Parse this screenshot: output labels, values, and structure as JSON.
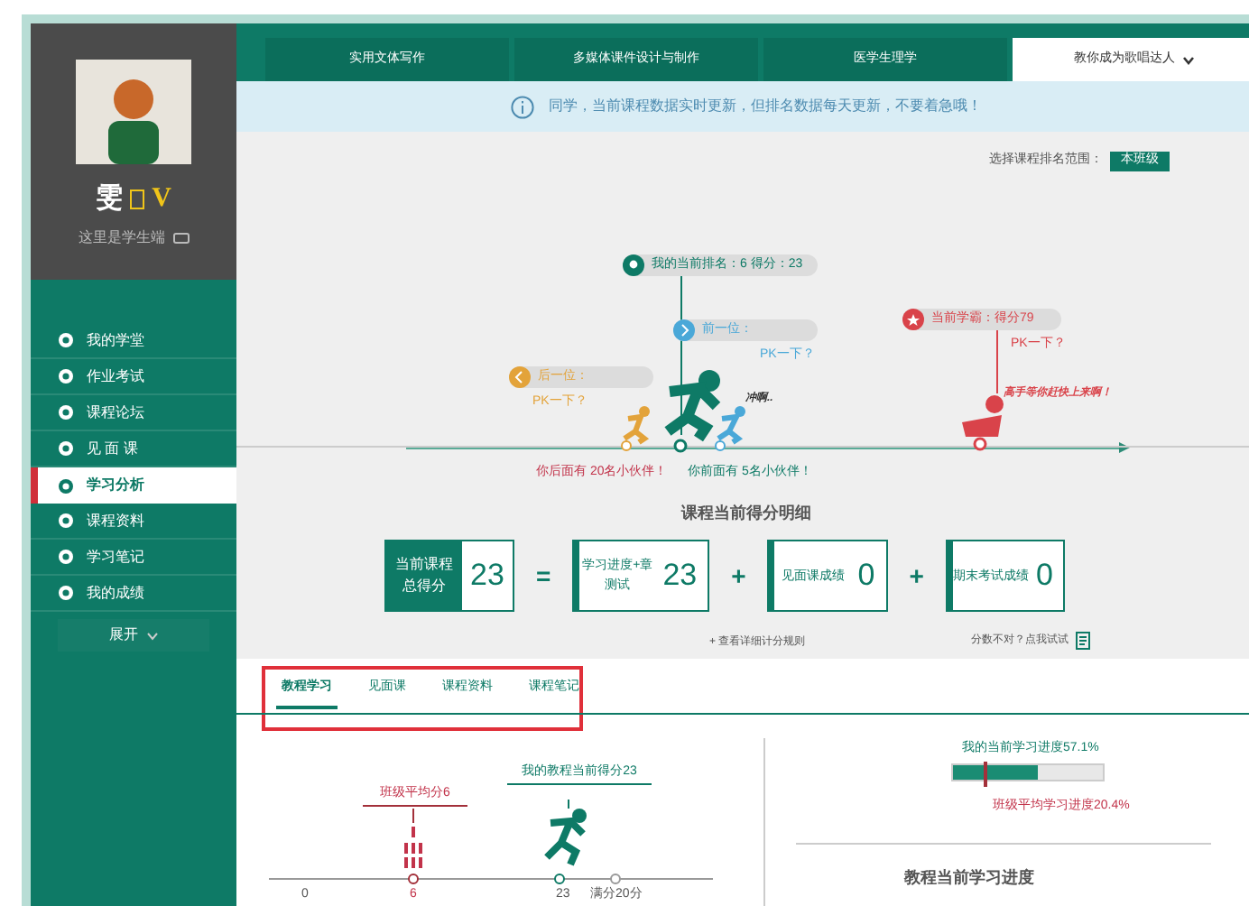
{
  "profile": {
    "name": "雯",
    "badge": "V",
    "subtitle": "这里是学生端"
  },
  "nav": [
    {
      "label": "我的学堂",
      "selected": false
    },
    {
      "label": "作业考试",
      "selected": false
    },
    {
      "label": "课程论坛",
      "selected": false
    },
    {
      "label": "见 面 课",
      "selected": false
    },
    {
      "label": "学习分析",
      "selected": true
    },
    {
      "label": "课程资料",
      "selected": false
    },
    {
      "label": "学习笔记",
      "selected": false
    },
    {
      "label": "我的成绩",
      "selected": false
    }
  ],
  "expand_button": "展开",
  "course_tabs": [
    {
      "label": "实用文体写作",
      "selected": false
    },
    {
      "label": "多媒体课件设计与制作",
      "selected": false
    },
    {
      "label": "医学生理学",
      "selected": false
    },
    {
      "label": "教你成为歌唱达人",
      "selected": true
    }
  ],
  "notice": "同学，当前课程数据实时更新，但排名数据每天更新，不要着急哦！",
  "range": {
    "label": "选择课程排名范围：",
    "value": "本班级"
  },
  "race": {
    "my_rank": "我的当前排名：6 得分：23",
    "next": {
      "label": "前一位：",
      "pk": "PK一下？"
    },
    "prev": {
      "label": "后一位：",
      "pk": "PK一下？"
    },
    "leader": {
      "label": "当前学霸：得分79",
      "pk": "PK一下？",
      "slogan": "高手等你赶快上来啊！"
    },
    "cheer": "冲啊..",
    "behind_text": "你后面有 20名小伙伴！",
    "ahead_text": "你前面有 5名小伙伴！"
  },
  "score": {
    "title": "课程当前得分明细",
    "total_label": "当前课程总得分",
    "total": "23",
    "parts": [
      {
        "operator": "=",
        "label": "学习进度+章测试",
        "value": "23"
      },
      {
        "operator": "+",
        "label": "见面课成绩",
        "value": "0"
      },
      {
        "operator": "+",
        "label": "期末考试成绩",
        "value": "0"
      }
    ],
    "rules_link": "+ 查看详细计分规则",
    "feedback": "分数不对？点我试试"
  },
  "detail_tabs": [
    {
      "label": "教程学习",
      "selected": true
    },
    {
      "label": "见面课",
      "selected": false
    },
    {
      "label": "课程资料",
      "selected": false
    },
    {
      "label": "课程笔记",
      "selected": false
    }
  ],
  "score_chart": {
    "avg_label": "班级平均分6",
    "my_label": "我的教程当前得分23",
    "ticks": [
      "0",
      "6",
      "23",
      "满分20分"
    ]
  },
  "progress": {
    "my_label": "我的当前学习进度57.1%",
    "level": 0.571,
    "avg": {
      "label": "班级平均学习进度20.4%",
      "level": 0.204
    },
    "title": "教程当前学习进度"
  }
}
